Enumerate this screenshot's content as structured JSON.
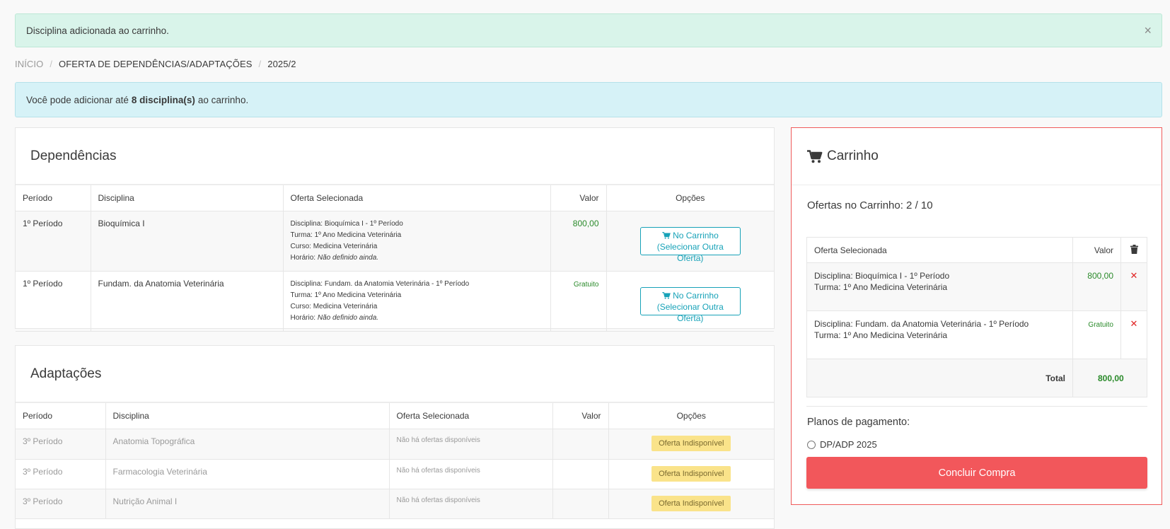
{
  "alert_success": {
    "message": "Disciplina adicionada ao carrinho.",
    "close": "×"
  },
  "breadcrumb": {
    "home": "INÍCIO",
    "section": "OFERTA DE DEPENDÊNCIAS/ADAPTAÇÕES",
    "term": "2025/2"
  },
  "alert_info": {
    "prefix": "Você pode adicionar até",
    "highlight": "8 disciplina(s)",
    "suffix": "ao carrinho."
  },
  "dependencias": {
    "title": "Dependências",
    "headers": {
      "periodo": "Período",
      "disciplina": "Disciplina",
      "oferta": "Oferta Selecionada",
      "valor": "Valor",
      "opcoes": "Opções"
    },
    "rows": [
      {
        "periodo": "1º Período",
        "disciplina": "Bioquímica I",
        "oferta_disciplina": "Disciplina: Bioquímica I - 1º Período",
        "oferta_turma": "Turma: 1º Ano Medicina Veterinária",
        "oferta_curso": "Curso: Medicina Veterinária",
        "oferta_horario_label": "Horário:",
        "oferta_horario": "Não definido ainda.",
        "valor": "800,00",
        "btn_line1": "No Carrinho",
        "btn_line2": "(Selecionar Outra Oferta)"
      },
      {
        "periodo": "1º Período",
        "disciplina": "Fundam. da Anatomia Veterinária",
        "oferta_disciplina": "Disciplina: Fundam. da Anatomia Veterinária - 1º Período",
        "oferta_turma": "Turma: 1º Ano Medicina Veterinária",
        "oferta_curso": "Curso: Medicina Veterinária",
        "oferta_horario_label": "Horário:",
        "oferta_horario": "Não definido ainda.",
        "valor": "Gratuito",
        "btn_line1": "No Carrinho",
        "btn_line2": "(Selecionar Outra Oferta)"
      }
    ]
  },
  "adaptacoes": {
    "title": "Adaptações",
    "headers": {
      "periodo": "Período",
      "disciplina": "Disciplina",
      "oferta": "Oferta Selecionada",
      "valor": "Valor",
      "opcoes": "Opções"
    },
    "rows": [
      {
        "periodo": "3º Período",
        "disciplina": "Anatomia Topográfica",
        "oferta": "Não há ofertas disponíveis",
        "status": "Oferta Indisponível"
      },
      {
        "periodo": "3º Período",
        "disciplina": "Farmacologia Veterinária",
        "oferta": "Não há ofertas disponíveis",
        "status": "Oferta Indisponível"
      },
      {
        "periodo": "3º Período",
        "disciplina": "Nutrição Animal I",
        "oferta": "Não há ofertas disponíveis",
        "status": "Oferta Indisponível"
      }
    ]
  },
  "cart": {
    "title": "Carrinho",
    "count_label": "Ofertas no Carrinho: 2 / 10",
    "headers": {
      "oferta": "Oferta Selecionada",
      "valor": "Valor"
    },
    "items": [
      {
        "line1": "Disciplina: Bioquímica I - 1º Período",
        "line2": "Turma: 1º Ano Medicina Veterinária",
        "valor": "800,00",
        "remove": "✕"
      },
      {
        "line1": "Disciplina: Fundam. da Anatomia Veterinária - 1º Período",
        "line2": "Turma: 1º Ano Medicina Veterinária",
        "valor": "Gratuito",
        "remove": "✕"
      }
    ],
    "total_label": "Total",
    "total_value": "800,00",
    "plans_title": "Planos de pagamento:",
    "plan_option": "DP/ADP 2025",
    "checkout_label": "Concluir Compra"
  },
  "colors": {
    "success_bg": "#d9f4ea",
    "info_bg": "#d6f2f7",
    "accent_teal": "#17a2b8",
    "danger": "#f2575b",
    "money_green": "#2a8a2a",
    "warning_badge": "#fae38a"
  },
  "icons": {
    "cart": "shopping-cart-icon",
    "trash": "trash-icon",
    "close": "close-icon"
  }
}
